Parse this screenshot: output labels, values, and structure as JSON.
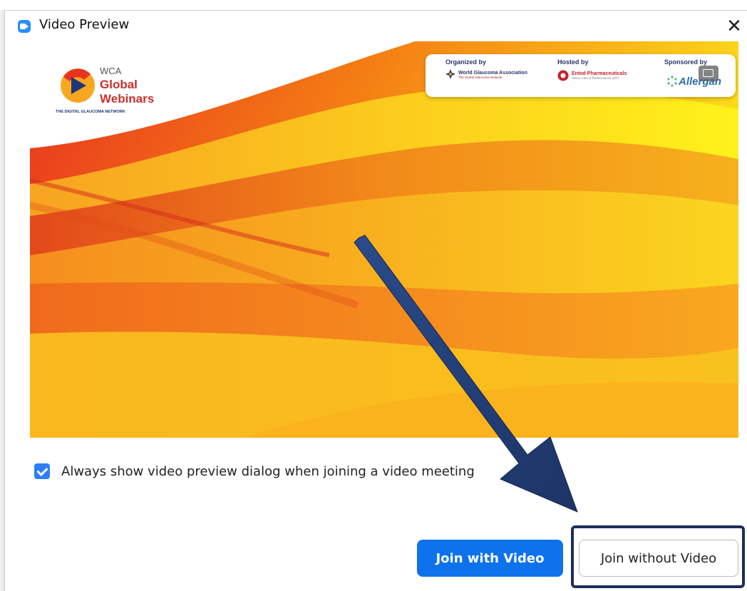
{
  "window": {
    "title": "Video Preview",
    "close_glyph": "✕",
    "app_icon": "zoom-camera-icon"
  },
  "preview": {
    "logo": {
      "line1": "WCA",
      "line2": "Global",
      "line3": "Webinars",
      "tagline": "THE DIGITAL GLAUCOMA NETWORK"
    },
    "sponsors": {
      "organized_label": "Organized by",
      "organized_name": "World Glaucoma Association",
      "organized_sub": "The Global Glaucoma Network",
      "hosted_label": "Hosted by",
      "hosted_name": "Entod Pharmaceuticals",
      "hosted_sub": "Vision Care & Perfect Since 1977",
      "sponsored_label": "Sponsored by",
      "sponsored_name": "Allergan"
    },
    "background_toggle_icon": "background-image-icon"
  },
  "checkbox": {
    "checked": true,
    "label": "Always show video preview dialog when joining a video meeting"
  },
  "buttons": {
    "join_with_video": "Join with Video",
    "join_without_video": "Join without Video"
  },
  "colors": {
    "accent_blue": "#0e72ed",
    "checkbox_blue": "#2d7ff9",
    "annotation_arrow": "#1f3a6e",
    "highlight_border": "#1d2e5a"
  }
}
